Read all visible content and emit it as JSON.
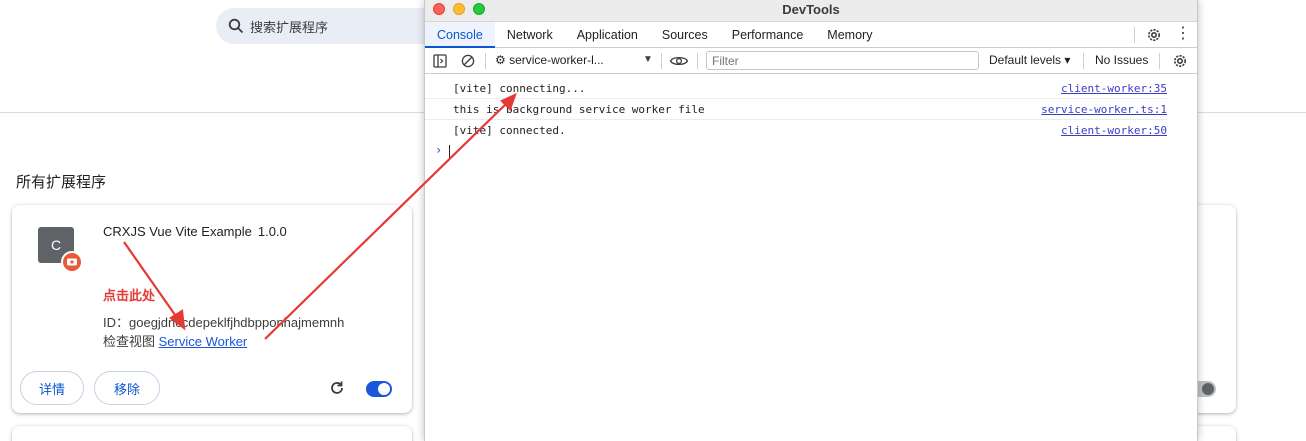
{
  "extensions_page": {
    "search_placeholder": "搜索扩展程序",
    "section_title": "所有扩展程序",
    "extension": {
      "icon_letter": "C",
      "name": "CRXJS Vue Vite Example",
      "version": "1.0.0",
      "id_label": "ID：goegjdnccdepeklfjhdbpponhajmemnh",
      "inspect_label": "检查视图",
      "inspect_link": "Service Worker",
      "details_button": "详情",
      "remove_button": "移除",
      "enabled": true
    },
    "annotation_note": "点击此处"
  },
  "devtools": {
    "window_title": "DevTools",
    "tabs": [
      {
        "label": "Console",
        "active": true
      },
      {
        "label": "Network",
        "active": false
      },
      {
        "label": "Application",
        "active": false
      },
      {
        "label": "Sources",
        "active": false
      },
      {
        "label": "Performance",
        "active": false
      },
      {
        "label": "Memory",
        "active": false
      }
    ],
    "toolbar": {
      "context": "⚙ service-worker-l...",
      "filter_placeholder": "Filter",
      "levels": "Default levels ▾",
      "issues": "No Issues"
    },
    "console_logs": [
      {
        "message": "[vite] connecting...",
        "source": "client-worker:35"
      },
      {
        "message": "this is background service worker file",
        "source": "service-worker.ts:1"
      },
      {
        "message": "[vite] connected.",
        "source": "client-worker:50"
      }
    ],
    "prompt_symbol": "›"
  },
  "colors": {
    "accent": "#0b57d0",
    "annotation": "#e53935",
    "toggle_on": "#1a56db"
  }
}
